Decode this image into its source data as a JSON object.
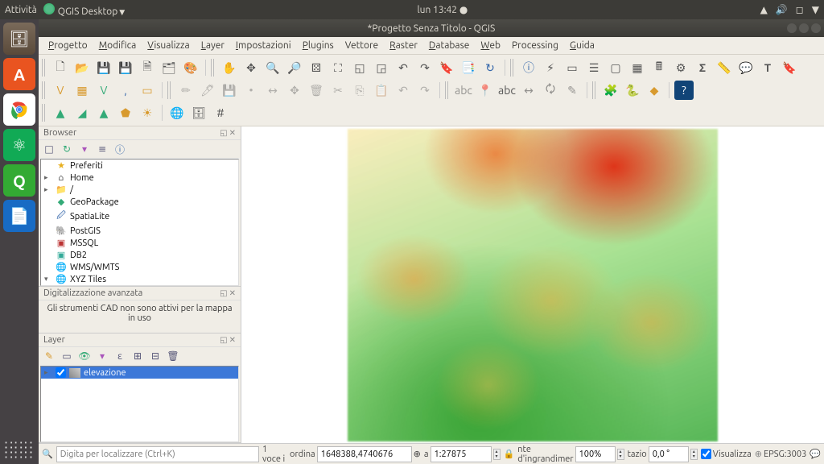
{
  "os": {
    "activities": "Attività",
    "app_menu": "QGIS Desktop",
    "clock": "lun 13:42 ●"
  },
  "window": {
    "title": "*Progetto Senza Titolo - QGIS"
  },
  "menu": [
    {
      "u": "P",
      "rest": "rogetto"
    },
    {
      "u": "M",
      "rest": "odifica"
    },
    {
      "u": "V",
      "rest": "isualizza"
    },
    {
      "u": "L",
      "rest": "ayer"
    },
    {
      "u": "I",
      "rest": "mpostazioni"
    },
    {
      "u": "P",
      "rest": "lugins"
    },
    {
      "u": "",
      "rest": "Vettore"
    },
    {
      "u": "R",
      "rest": "aster"
    },
    {
      "u": "D",
      "rest": "atabase"
    },
    {
      "u": "W",
      "rest": "eb"
    },
    {
      "u": "",
      "rest": "Processing"
    },
    {
      "u": "G",
      "rest": "uida"
    }
  ],
  "browser": {
    "title": "Browser",
    "items": [
      {
        "exp": "",
        "ico": "★",
        "label": "Preferiti",
        "color": "#e8b020"
      },
      {
        "exp": "▸",
        "ico": "⌂",
        "label": "Home"
      },
      {
        "exp": "▸",
        "ico": "📁",
        "label": "/"
      },
      {
        "exp": "",
        "ico": "◆",
        "label": "GeoPackage",
        "color": "#3a7"
      },
      {
        "exp": "",
        "ico": "🖉",
        "label": "SpatiaLite",
        "color": "#36a"
      },
      {
        "exp": "",
        "ico": "🐘",
        "label": "PostGIS",
        "color": "#36a"
      },
      {
        "exp": "",
        "ico": "▣",
        "label": "MSSQL",
        "color": "#b33"
      },
      {
        "exp": "",
        "ico": "▣",
        "label": "DB2",
        "color": "#3a9"
      },
      {
        "exp": "",
        "ico": "🌐",
        "label": "WMS/WMTS",
        "color": "#36a"
      },
      {
        "exp": "▾",
        "ico": "🌐",
        "label": "XYZ Tiles",
        "color": "#3a7"
      }
    ]
  },
  "digitizing": {
    "title": "Digitalizzazione avanzata",
    "message": "Gli strumenti CAD non sono attivi per la mappa in uso"
  },
  "layers": {
    "title": "Layer",
    "item": "elevazione"
  },
  "status": {
    "locator_placeholder": "Digita per localizzare (Ctrl+K)",
    "feature_count": "1 voce i",
    "coord_label": "ordina",
    "coord": "1648388,4740676",
    "scale_label": "a",
    "scale": "1:27875",
    "magnifier_label": "nte d'ingrandimer",
    "magnifier": "100%",
    "rotation_label": "tazio",
    "rotation": "0,0 °",
    "render": "Visualizza",
    "crs": "EPSG:3003"
  }
}
